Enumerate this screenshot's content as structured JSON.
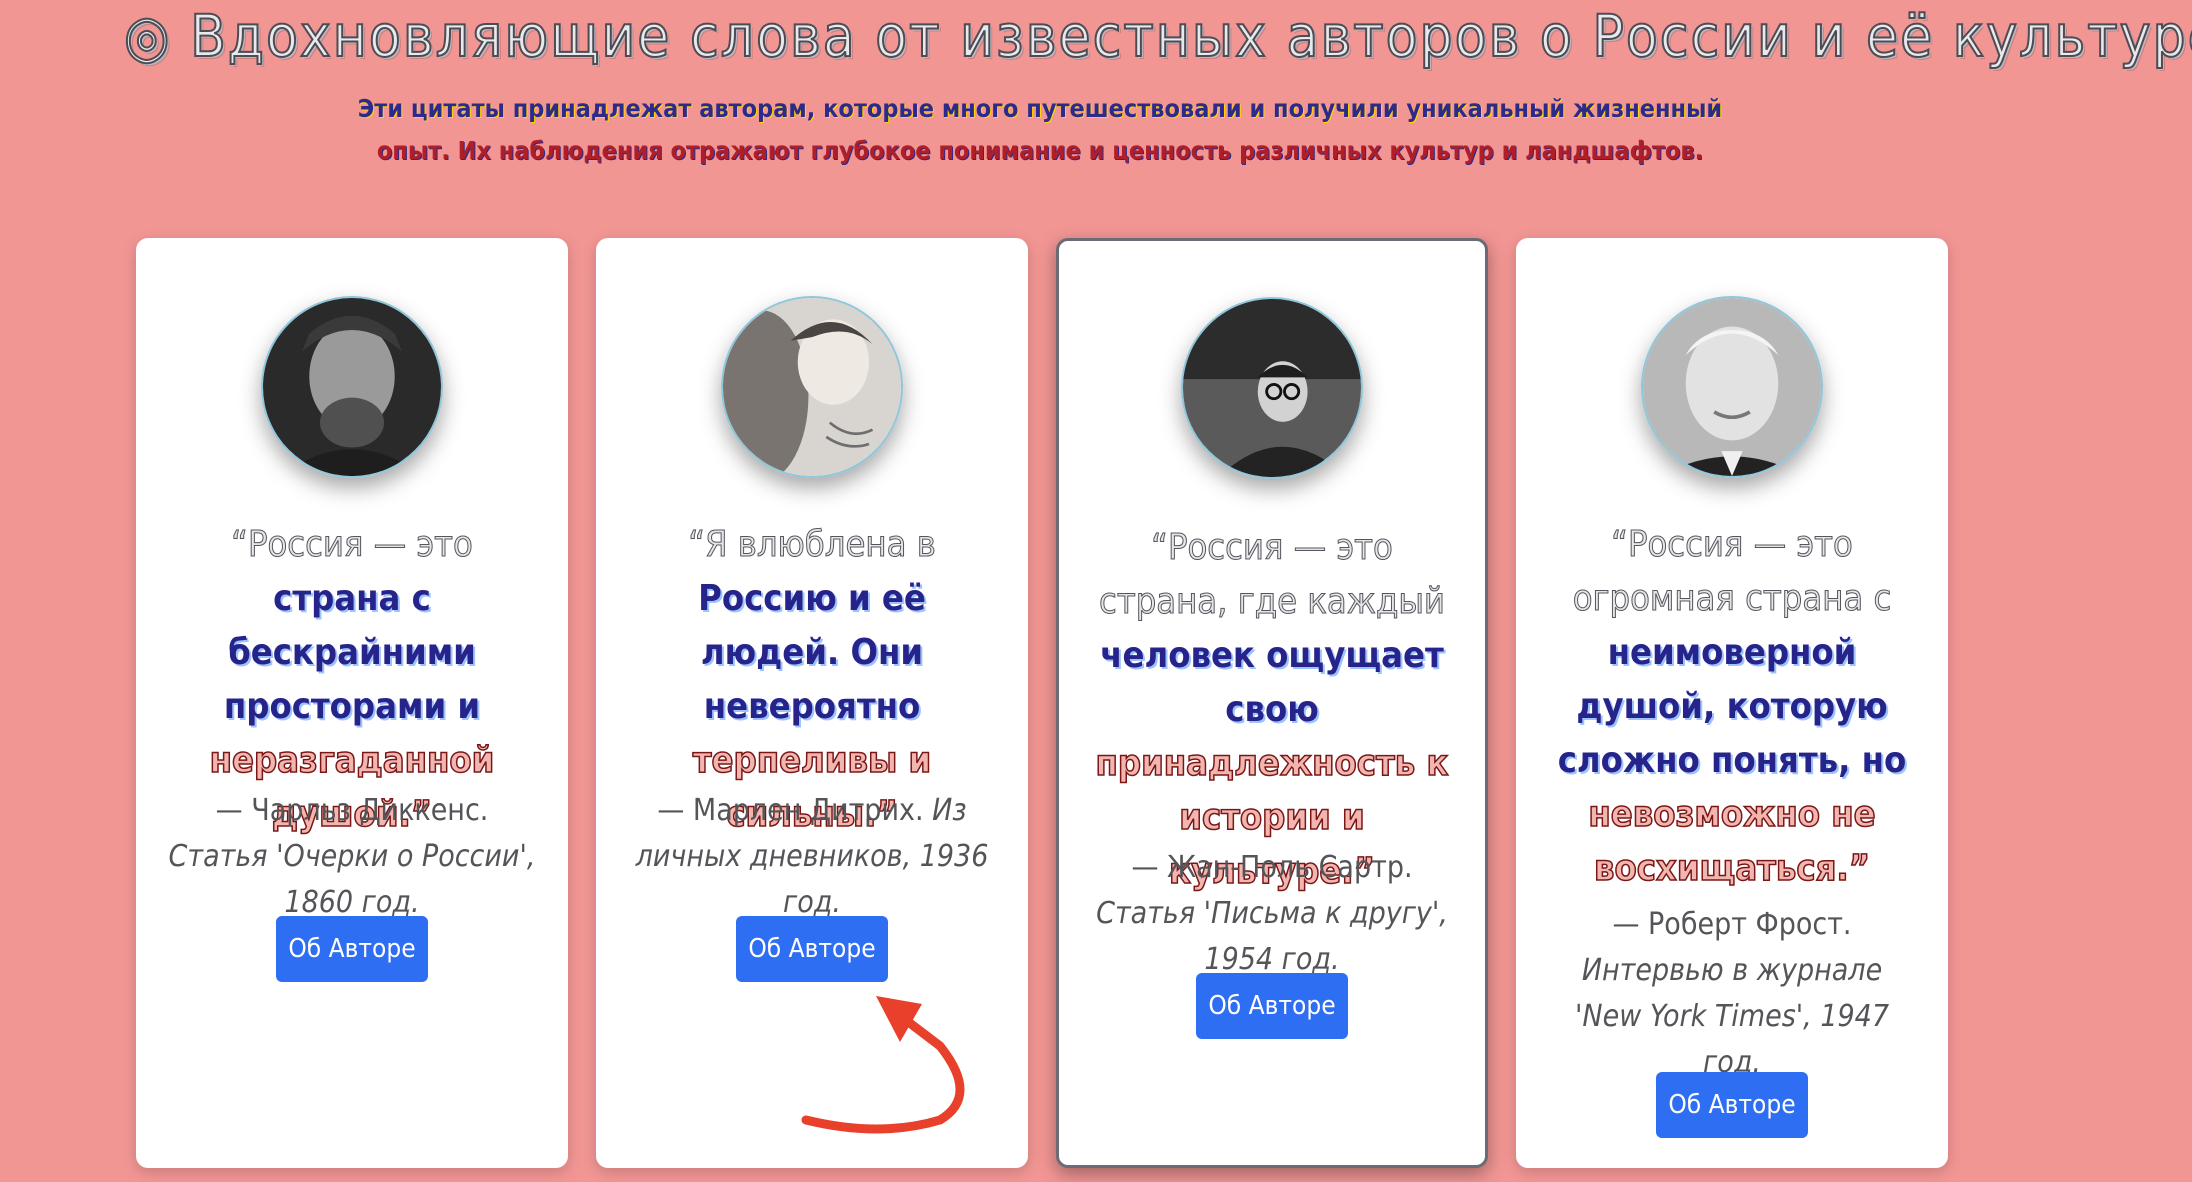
{
  "header": {
    "title": "◎ Вдохновляющие слова от известных авторов о России и её культуре◎",
    "subtitle_line1": "Эти цитаты принадлежат авторам, которые много путешествовали и получили уникальный жизненный",
    "subtitle_line2": "опыт. Их наблюдения отражают глубокое понимание и ценность различных культур и ландшафтов."
  },
  "cards": [
    {
      "quote": {
        "gray": "“Россия — это",
        "blue": "страна с бескрайними просторами и",
        "red": "неразгаданной душой.”"
      },
      "author": "— Чарльз Диккенс.",
      "source": "Статья 'Очерки о России', 1860 год.",
      "button": "Об Авторе"
    },
    {
      "quote": {
        "gray": "“Я влюблена в",
        "blue": "Россию и её людей. Они невероятно",
        "red": "терпеливы и сильны.”"
      },
      "author": "— Марлен Дитрих.",
      "source": "Из личных дневников, 1936 год.",
      "button": "Об Авторе"
    },
    {
      "quote": {
        "gray": "“Россия — это страна, где каждый",
        "blue": "человек ощущает свою",
        "red": "принадлежность к истории и культуре.”"
      },
      "author": "— Жан-Поль Сартр.",
      "source": "Статья 'Письма к другу', 1954 год.",
      "button": "Об Авторе"
    },
    {
      "quote": {
        "gray": "“Россия — это огромная страна с",
        "blue": "неимоверной душой, которую сложно понять, но",
        "red": "невозможно не восхищаться.”"
      },
      "author": "— Роберт Фрост.",
      "source": "Интервью в журнале 'New York Times', 1947 год.",
      "button": "Об Авторе"
    }
  ],
  "colors": {
    "background": "#f29694",
    "button": "#2e6ef3",
    "annotation_arrow": "#e8402a"
  }
}
